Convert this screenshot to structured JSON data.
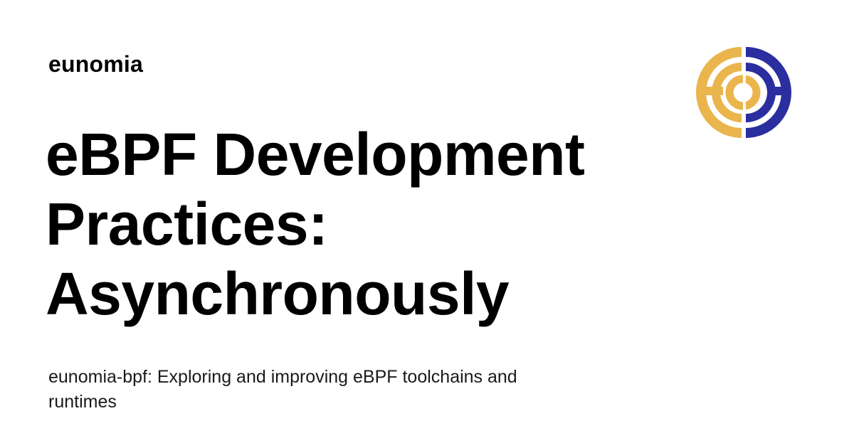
{
  "site": {
    "name": "eunomia"
  },
  "post": {
    "title": "eBPF Development Practices: Asynchronously",
    "description": "eunomia-bpf: Exploring and improving eBPF toolchains and runtimes"
  },
  "logo": {
    "icon": "eunomia-logo-icon",
    "colors": {
      "gold": "#EAB54D",
      "navy": "#2B2E9E"
    }
  }
}
